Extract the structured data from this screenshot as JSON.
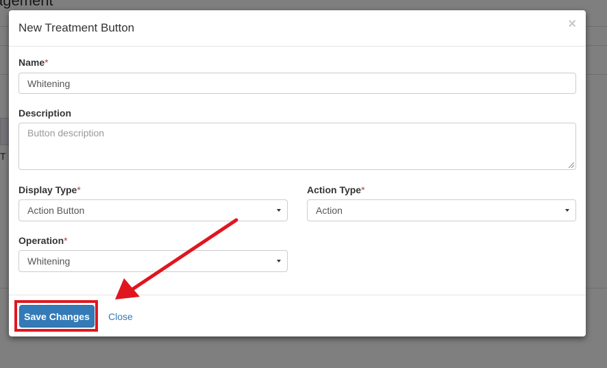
{
  "background": {
    "title_fragment": "agement",
    "side_text": "T"
  },
  "modal": {
    "title": "New Treatment Button",
    "close_icon": "×"
  },
  "form": {
    "name": {
      "label": "Name",
      "required_mark": "*",
      "value": "Whitening"
    },
    "description": {
      "label": "Description",
      "placeholder": "Button description",
      "value": ""
    },
    "display_type": {
      "label": "Display Type",
      "required_mark": "*",
      "selected": "Action Button"
    },
    "action_type": {
      "label": "Action Type",
      "required_mark": "*",
      "selected": "Action"
    },
    "operation": {
      "label": "Operation",
      "required_mark": "*",
      "selected": "Whitening"
    }
  },
  "footer": {
    "save_label": "Save Changes",
    "close_label": "Close"
  },
  "annotation": {
    "highlight_color": "#e0161f",
    "arrow_color": "#e0161f"
  },
  "colors": {
    "primary": "#337ab7",
    "required": "#a94442"
  }
}
